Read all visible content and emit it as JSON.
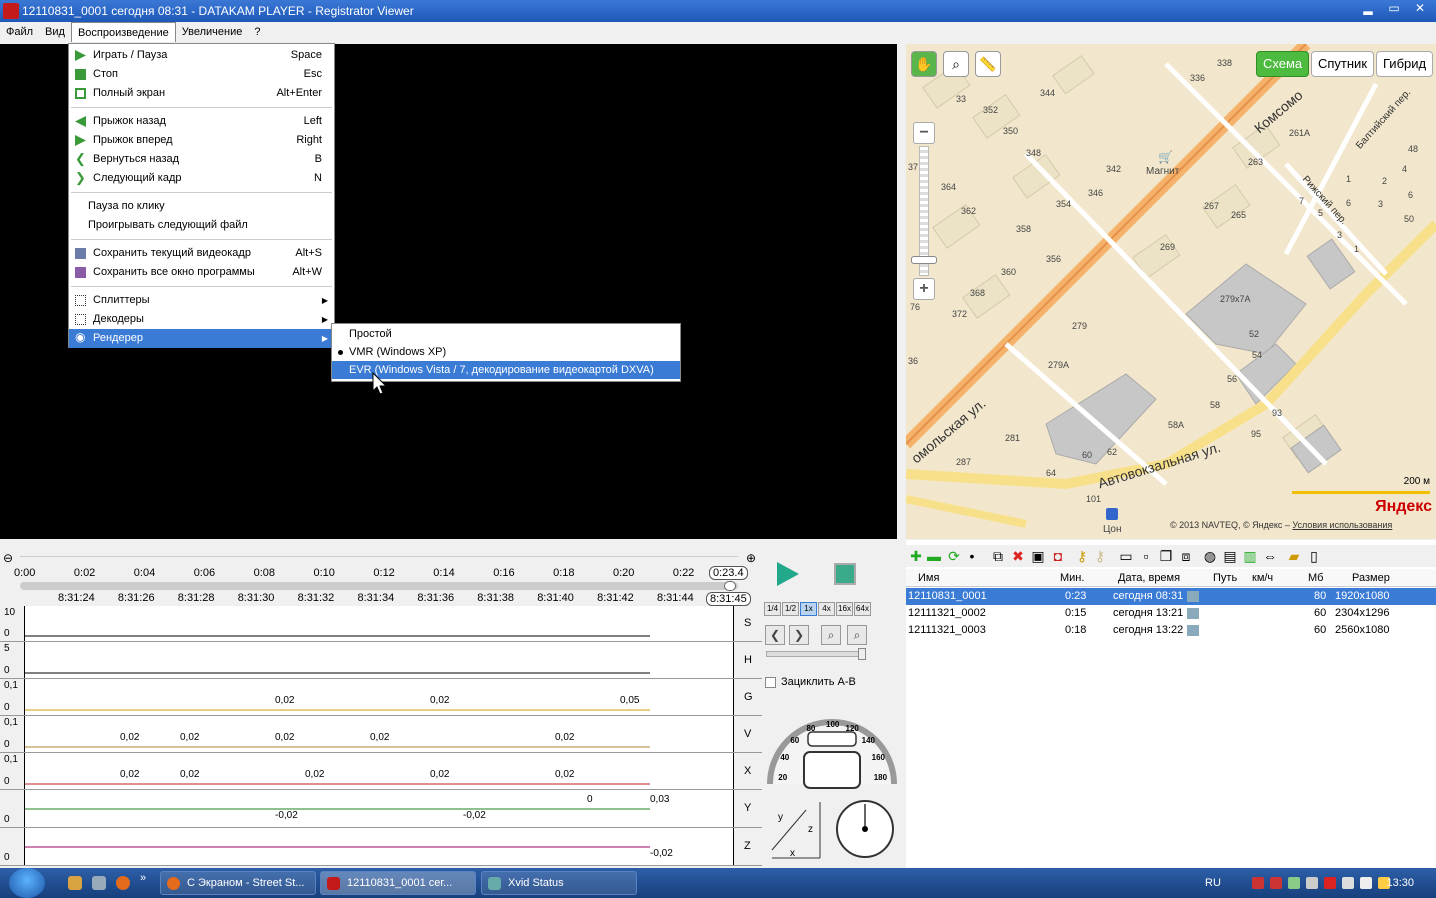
{
  "window": {
    "title": "12110831_0001    сегодня 08:31  -  DATAKAM PLAYER - Registrator Viewer",
    "min": "▂",
    "max": "▭",
    "close": "✕"
  },
  "menubar": [
    "Файл",
    "Вид",
    "Воспроизведение",
    "Увеличение",
    "?"
  ],
  "playback_menu": {
    "group1": [
      {
        "label": "Играть / Пауза",
        "shortcut": "Space",
        "icon": "play-icon"
      },
      {
        "label": "Стоп",
        "shortcut": "Esc",
        "icon": "stop-icon"
      },
      {
        "label": "Полный экран",
        "shortcut": "Alt+Enter",
        "icon": "fullscreen-icon"
      }
    ],
    "group2": [
      {
        "label": "Прыжок назад",
        "shortcut": "Left",
        "icon": "jump-back-icon"
      },
      {
        "label": "Прыжок вперед",
        "shortcut": "Right",
        "icon": "jump-forward-icon"
      },
      {
        "label": "Вернуться назад",
        "shortcut": "B",
        "icon": "back-icon"
      },
      {
        "label": "Следующий кадр",
        "shortcut": "N",
        "icon": "next-frame-icon"
      }
    ],
    "group3": [
      {
        "label": "Пауза по клику"
      },
      {
        "label": "Проигрывать следующий файл"
      }
    ],
    "group4": [
      {
        "label": "Сохранить текущий видеокадр",
        "shortcut": "Alt+S",
        "icon": "save-frame-icon"
      },
      {
        "label": "Сохранить все окно программы",
        "shortcut": "Alt+W",
        "icon": "save-window-icon"
      }
    ],
    "group5": [
      {
        "label": "Сплиттеры",
        "icon": "splitter-icon"
      },
      {
        "label": "Декодеры",
        "icon": "decoder-icon"
      },
      {
        "label": "Рендерер",
        "icon": "eye-icon"
      }
    ]
  },
  "renderer_submenu": [
    {
      "label": "Простой"
    },
    {
      "label": "VMR (Windows XP)"
    },
    {
      "label": "EVR (Windows Vista / 7, декодирование видеокартой DXVA)"
    }
  ],
  "map": {
    "tools": [
      "✋",
      "⌕",
      "📏"
    ],
    "types": [
      "Схема",
      "Спутник",
      "Гибрид"
    ],
    "zoom_in": "+",
    "zoom_out": "−",
    "scale": "200 м",
    "logo": "Яндекс",
    "copyright": "© 2013 NAVTEQ, © Яндекс – ",
    "terms": "Условия использования",
    "streets": [
      "Комсомо",
      "омольская ул.",
      "Автовокзальная ул.",
      "Рижский пер.",
      "Балтийский пер."
    ],
    "poi": [
      "Магнит",
      "Цон"
    ],
    "buildings": [
      "338",
      "336",
      "33",
      "352",
      "344",
      "350",
      "348",
      "342",
      "364",
      "346",
      "354",
      "362",
      "358",
      "356",
      "360",
      "368",
      "372",
      "279",
      "279А",
      "281",
      "287",
      "64",
      "60",
      "62",
      "101",
      "58",
      "56",
      "58А",
      "95",
      "93",
      "52",
      "54",
      "279х7А",
      "269",
      "267",
      "265",
      "263",
      "261А",
      "7",
      "5",
      "3",
      "1",
      "2",
      "4",
      "6",
      "48",
      "50",
      "3",
      "1",
      "6",
      "76",
      "36",
      "37"
    ]
  },
  "timeline": {
    "ticks": [
      "0:00",
      "0:02",
      "0:04",
      "0:06",
      "0:08",
      "0:10",
      "0:12",
      "0:14",
      "0:16",
      "0:18",
      "0:20",
      "0:22"
    ],
    "current": "0:23.4",
    "clock_ticks": [
      "8:31:24",
      "8:31:26",
      "8:31:28",
      "8:31:30",
      "8:31:32",
      "8:31:34",
      "8:31:36",
      "8:31:38",
      "8:31:40",
      "8:31:42",
      "8:31:44"
    ],
    "clock_current": "8:31:45"
  },
  "graphs": [
    {
      "name": "S",
      "top": "10",
      "bottom": "0",
      "values": []
    },
    {
      "name": "H",
      "top": "5",
      "bottom": "0",
      "values": []
    },
    {
      "name": "G",
      "top": "0,1",
      "bottom": "0",
      "values": [
        "0,02",
        "0,02",
        "0,05"
      ]
    },
    {
      "name": "V",
      "top": "0,1",
      "bottom": "0",
      "values": [
        "0,02",
        "0,02",
        "0,02",
        "0,02",
        "0,02"
      ]
    },
    {
      "name": "X",
      "top": "0,1",
      "bottom": "0",
      "values": [
        "0,02",
        "0,02",
        "0,02",
        "0,02",
        "0,02"
      ]
    },
    {
      "name": "Y",
      "top": "",
      "bottom": "0",
      "values": [
        "-0,02",
        "-0,02",
        "0",
        "0,03"
      ]
    },
    {
      "name": "Z",
      "top": "",
      "bottom": "0",
      "values": [
        "-0,02"
      ]
    }
  ],
  "controls": {
    "speeds": [
      "1/4",
      "1/2",
      "1x",
      "4x",
      "16x",
      "64x"
    ],
    "loop_label": "Зациклить A-B",
    "speedo": [
      "20",
      "40",
      "60",
      "80",
      "100",
      "120",
      "140",
      "160",
      "180",
      "200",
      "0"
    ],
    "axes": [
      "y",
      "z",
      "x"
    ]
  },
  "list": {
    "headers": [
      "Имя",
      "Мин.",
      "Дата, время",
      "Путь",
      "км/ч",
      "Мб",
      "Размер"
    ],
    "rows": [
      {
        "name": "12110831_0001",
        "min": "0:23",
        "date": "сегодня 08:31",
        "mb": "80",
        "size": "1920x1080"
      },
      {
        "name": "12111321_0002",
        "min": "0:15",
        "date": "сегодня 13:21",
        "mb": "60",
        "size": "2304x1296"
      },
      {
        "name": "12111321_0003",
        "min": "0:18",
        "date": "сегодня 13:22",
        "mb": "60",
        "size": "2560x1080"
      }
    ]
  },
  "taskbar": {
    "buttons": [
      "С Экраном - Street St...",
      "12110831_0001    сег...",
      "Xvid Status"
    ],
    "lang": "RU",
    "clock": "13:30",
    "chevron": "»"
  }
}
